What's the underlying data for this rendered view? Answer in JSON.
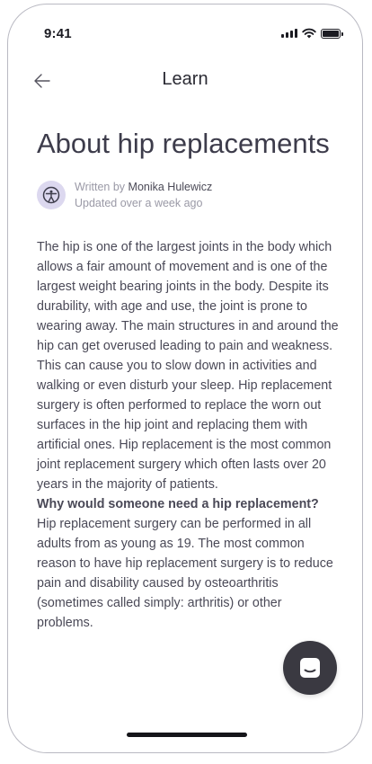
{
  "status_bar": {
    "time": "9:41"
  },
  "nav": {
    "title": "Learn"
  },
  "article": {
    "title": "About hip replacements",
    "author_prefix": "Written by",
    "author_name": "Monika Hulewicz",
    "updated": "Updated over a week ago",
    "paragraph_1": "The hip is one of the largest joints in the body which allows a fair amount of movement and is one of the largest weight bearing joints in the body. Despite its durability, with age and use, the joint is prone to wearing away. The main structures in and around the hip can get overused leading to pain and weakness. This can cause you to slow down in activities and walking or even disturb your sleep. Hip replacement surgery  is often performed to replace the worn out surfaces in  the hip joint and replacing them with artificial ones. Hip replacement is the most common joint replacement surgery which often lasts over 20 years in the majority of patients.",
    "section_heading": "Why would someone need a hip replacement?",
    "paragraph_2": "Hip replacement surgery can be performed in all adults from as young as 19. The most common reason to have hip replacement surgery is to reduce pain and disability caused by osteoarthritis (sometimes called simply: arthritis) or other problems."
  },
  "icons": {
    "back": "arrow-left-icon",
    "avatar": "person-circle-icon",
    "chat": "chat-bubble-icon",
    "signal": "cellular-signal-icon",
    "wifi": "wifi-icon",
    "battery": "battery-icon"
  },
  "colors": {
    "avatar_bg": "#dcd8ef",
    "fab_bg": "#3a3941",
    "text": "#4a4957"
  }
}
